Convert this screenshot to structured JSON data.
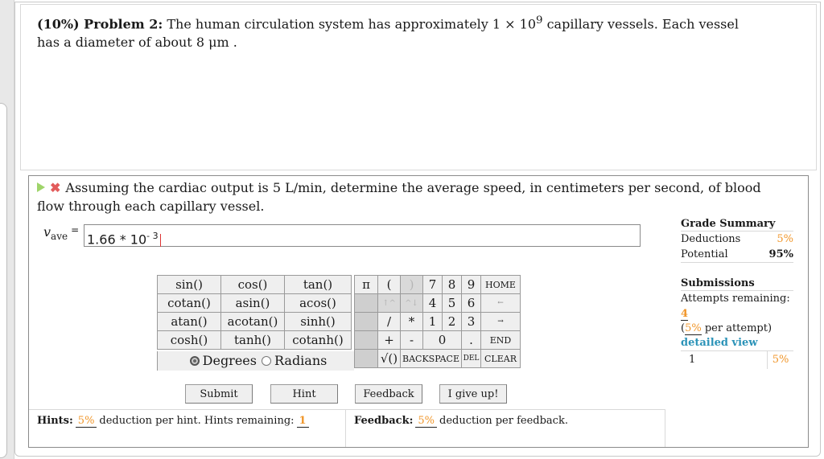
{
  "problem": {
    "label": "(10%) Problem 2:",
    "text_before": " The human circulation system has approximately 1 × 10",
    "exp": "9",
    "text_after": " capillary vessels. Each vessel has a diameter of about 8 μm ."
  },
  "part": {
    "question": "Assuming the cardiac output is 5 L/min, determine the average speed, in centimeters per second, of blood flow through each capillary vessel.",
    "icons": [
      "play-icon",
      "incorrect-x-icon"
    ],
    "variable": "v",
    "variable_sub": "ave",
    "equals": "=",
    "answer_base": "1.66 * 10",
    "answer_exp": "- 3"
  },
  "calculator": {
    "functions": [
      [
        "sin()",
        "cos()",
        "tan()"
      ],
      [
        "cotan()",
        "asin()",
        "acos()"
      ],
      [
        "atan()",
        "acotan()",
        "sinh()"
      ],
      [
        "cosh()",
        "tanh()",
        "cotanh()"
      ]
    ],
    "angle_mode": {
      "degrees": "Degrees",
      "radians": "Radians",
      "selected": "Degrees"
    },
    "keys": {
      "pi": "π",
      "lparen": "(",
      "rparen": ")",
      "k7": "7",
      "k8": "8",
      "k9": "9",
      "home": "HOME",
      "up": "↑^",
      "down": "^↓",
      "k4": "4",
      "k5": "5",
      "k6": "6",
      "left": "←",
      "div": "/",
      "mul": "*",
      "k1": "1",
      "k2": "2",
      "k3": "3",
      "right": "→",
      "plus": "+",
      "minus": "-",
      "k0": "0",
      "dot": ".",
      "end": "END",
      "sqrt": "√()",
      "backspace": "BACKSPACE",
      "del": "DEL",
      "clear": "CLEAR"
    }
  },
  "grade_summary": {
    "title": "Grade Summary",
    "deductions_label": "Deductions",
    "deductions_value": "5%",
    "potential_label": "Potential",
    "potential_value": "95%"
  },
  "submissions": {
    "title": "Submissions",
    "attempts_label": "Attempts remaining: ",
    "attempts_value": "4",
    "per_attempt_open": "(",
    "per_attempt_value": "5%",
    "per_attempt_text": " per attempt)",
    "detailed_view": "detailed view",
    "rows": [
      {
        "num": "1",
        "deduction": "5%"
      }
    ]
  },
  "buttons": {
    "submit": "Submit",
    "hint": "Hint",
    "feedback": "Feedback",
    "give_up": "I give up!"
  },
  "hints": {
    "label": "Hints:",
    "pct": "5%",
    "text": "deduction per hint. Hints remaining:",
    "remaining": "1"
  },
  "feedback": {
    "label": "Feedback:",
    "pct": "5%",
    "text": "deduction per feedback."
  },
  "colors": {
    "accent_orange": "#f0962a",
    "link_blue": "#2b93b8",
    "incorrect_red": "#e25b5b",
    "play_green": "#9fd46a"
  }
}
